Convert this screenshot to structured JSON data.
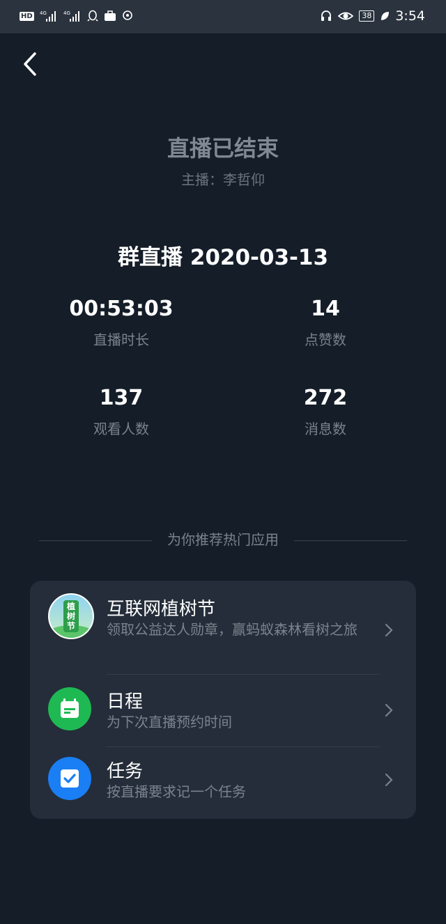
{
  "status_bar": {
    "left_icons": [
      "hd-icon",
      "signal-4g-1-icon",
      "signal-4g-2-icon",
      "qq-icon",
      "briefcase-icon",
      "sync-icon"
    ],
    "hd_label": "HD",
    "battery": "38",
    "time": "3:54"
  },
  "header": {
    "title": "直播已结束",
    "host": "主播：李哲仰"
  },
  "session": {
    "title": "群直播 2020-03-13"
  },
  "stats": [
    {
      "value": "00:53:03",
      "label": "直播时长"
    },
    {
      "value": "14",
      "label": "点赞数"
    },
    {
      "value": "137",
      "label": "观看人数"
    },
    {
      "value": "272",
      "label": "消息数"
    }
  ],
  "recommend": {
    "heading": "为你推荐热门应用",
    "apps": [
      {
        "name": "互联网植树节",
        "desc": "领取公益达人勋章，赢蚂蚁森林看树之旅",
        "icon": "tree-festival-icon",
        "icon_text": "植树节"
      },
      {
        "name": "日程",
        "desc": "为下次直播预约时间",
        "icon": "calendar-icon",
        "color": "#1fb954"
      },
      {
        "name": "任务",
        "desc": "按直播要求记一个任务",
        "icon": "task-check-icon",
        "color": "#1a7ef5"
      }
    ]
  }
}
